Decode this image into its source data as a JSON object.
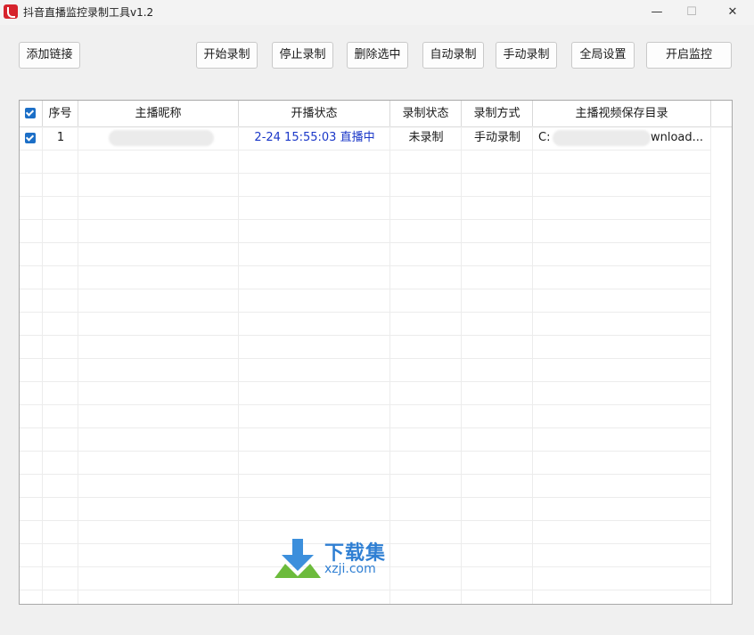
{
  "window": {
    "title": "抖音直播监控录制工具v1.2",
    "minimize": "—",
    "maximize": "☐",
    "close": "✕"
  },
  "toolbar": {
    "add_link": "添加链接",
    "start_record": "开始录制",
    "stop_record": "停止录制",
    "delete_selected": "删除选中",
    "auto_record": "自动录制",
    "manual_record": "手动录制",
    "global_settings": "全局设置",
    "start_monitor": "开启监控"
  },
  "table": {
    "columns": [
      "序号",
      "主播昵称",
      "开播状态",
      "录制状态",
      "录制方式",
      "主播视频保存目录"
    ],
    "rows": [
      {
        "checked": true,
        "index": "1",
        "nickname": "",
        "live_status": "2-24 15:55:03 直播中",
        "record_status": "未录制",
        "record_mode": "手动录制",
        "save_dir_start": "C:",
        "save_dir_end": "wnload..."
      }
    ]
  },
  "watermark": {
    "cn": "下载集",
    "domain": "xzji.com"
  },
  "colors": {
    "accent": "#1c6fc7",
    "live_text": "#1a37c8",
    "app_icon": "#d6232c"
  }
}
